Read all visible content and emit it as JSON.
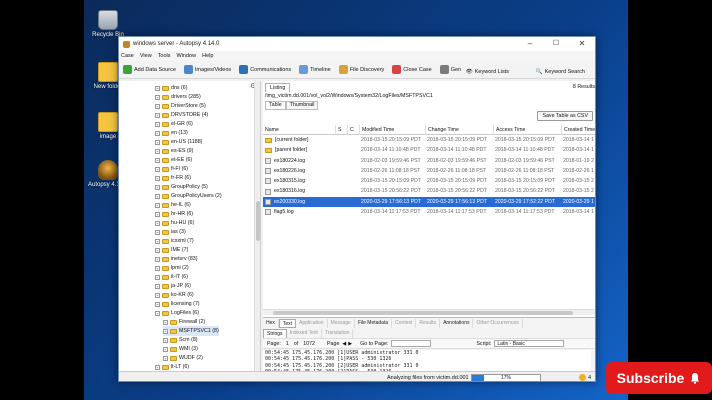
{
  "desktop": {
    "icons": [
      {
        "label": "Recycle Bin",
        "type": "bin"
      },
      {
        "label": "New folder",
        "type": "folder"
      },
      {
        "label": "image",
        "type": "folder"
      },
      {
        "label": "Autopsy 4.14.0",
        "type": "autopsy"
      }
    ]
  },
  "window": {
    "title": "windows server - Autopsy 4.14.0",
    "controls": [
      "–",
      "☐",
      "✕"
    ]
  },
  "menu": [
    "Case",
    "View",
    "Tools",
    "Window",
    "Help"
  ],
  "toolbar": {
    "buttons": [
      {
        "label": "Add Data Source",
        "icon": "plus-icon",
        "color": "#3aa33a"
      },
      {
        "label": "Images/Videos",
        "icon": "image-icon",
        "color": "#4a86c8"
      },
      {
        "label": "Communications",
        "icon": "comm-icon",
        "color": "#2f6fb5"
      },
      {
        "label": "Timeline",
        "icon": "timeline-icon",
        "color": "#6a9bd8"
      },
      {
        "label": "File Discovery",
        "icon": "discovery-icon",
        "color": "#d8a23a"
      },
      {
        "label": "Close Case",
        "icon": "close-case-icon",
        "color": "#d64545"
      },
      {
        "label": "Gen",
        "icon": "report-icon",
        "color": "#7a7a7a"
      }
    ],
    "keyword_lists": "Keyword Lists",
    "keyword_search": "Keyword Search"
  },
  "tree": {
    "items": [
      {
        "label": "dns (6)",
        "indent": 2,
        "plus": true
      },
      {
        "label": "drivers (285)",
        "indent": 2,
        "plus": true
      },
      {
        "label": "DriverStore (5)",
        "indent": 2,
        "plus": true
      },
      {
        "label": "DRVSTORE (4)",
        "indent": 2,
        "plus": true
      },
      {
        "label": "el-GR (6)",
        "indent": 2,
        "plus": true
      },
      {
        "label": "en (13)",
        "indent": 2,
        "plus": true
      },
      {
        "label": "en-US (1188)",
        "indent": 2,
        "plus": true
      },
      {
        "label": "es-ES (9)",
        "indent": 2,
        "plus": true
      },
      {
        "label": "et-EE (6)",
        "indent": 2,
        "plus": true
      },
      {
        "label": "fi-FI (6)",
        "indent": 2,
        "plus": true
      },
      {
        "label": "fr-FR (6)",
        "indent": 2,
        "plus": true
      },
      {
        "label": "GroupPolicy (5)",
        "indent": 2,
        "plus": true
      },
      {
        "label": "GroupPolicyUsers (2)",
        "indent": 2,
        "plus": true
      },
      {
        "label": "he-IL (6)",
        "indent": 2,
        "plus": true
      },
      {
        "label": "hr-HR (6)",
        "indent": 2,
        "plus": true
      },
      {
        "label": "hu-HU (6)",
        "indent": 2,
        "plus": true
      },
      {
        "label": "ias (3)",
        "indent": 2,
        "plus": true
      },
      {
        "label": "icsxml (7)",
        "indent": 2,
        "plus": true
      },
      {
        "label": "IME (7)",
        "indent": 2,
        "plus": true
      },
      {
        "label": "inetsrv (83)",
        "indent": 2,
        "plus": true
      },
      {
        "label": "lpmi (2)",
        "indent": 2,
        "plus": true
      },
      {
        "label": "it-IT (6)",
        "indent": 2,
        "plus": true
      },
      {
        "label": "ja-JP (6)",
        "indent": 2,
        "plus": true
      },
      {
        "label": "ko-KR (6)",
        "indent": 2,
        "plus": true
      },
      {
        "label": "licensing (7)",
        "indent": 2,
        "plus": true
      },
      {
        "label": "LogFiles (6)",
        "indent": 2,
        "plus": true
      },
      {
        "label": "Firewall (2)",
        "indent": 3,
        "plus": true
      },
      {
        "label": "MSFTPSVC1 (8)",
        "indent": 3,
        "plus": true
      },
      {
        "label": "Scm (8)",
        "indent": 3,
        "plus": true
      },
      {
        "label": "WMI (3)",
        "indent": 3,
        "plus": true
      },
      {
        "label": "WUDF (2)",
        "indent": 3,
        "plus": true
      },
      {
        "label": "lt-LT (6)",
        "indent": 2,
        "plus": true
      }
    ]
  },
  "listing": {
    "tab": "Listing",
    "path": "/img_victim.dd.001/vol_vol2/Windows/System32/LogFiles/MSFTPSVC1",
    "results": "8  Results",
    "subtabs": [
      "Table",
      "Thumbnail"
    ],
    "save_button": "Save Table as CSV",
    "columns": [
      "Name",
      "S",
      "C",
      "Modified Time",
      "Change Time",
      "Access Time",
      "Created Time"
    ],
    "rows": [
      {
        "name": "[current folder]",
        "kind": "dir",
        "modified": "2018-03-15 20:15:09 PDT",
        "change": "2018-03-15 20:15:09 PDT",
        "access": "2018-03-15 20:15:09 PDT",
        "created": "2018-03-14 1",
        "selected": false
      },
      {
        "name": "[parent folder]",
        "kind": "dir",
        "modified": "2018-03-14 11:10:48 PDT",
        "change": "2018-03-14 11:10:48 PDT",
        "access": "2018-03-14 11:10:48 PDT",
        "created": "2018-03-14 1",
        "selected": false
      },
      {
        "name": "ex180224.log",
        "kind": "file",
        "modified": "2018-02-03 19:59:46 PST",
        "change": "2018-02-03 19:59:46 PST",
        "access": "2018-02-03 19:59:46 PST",
        "created": "2018-01-19 2",
        "selected": false
      },
      {
        "name": "ex180226.log",
        "kind": "file",
        "modified": "2018-02-26 11:08:18 PST",
        "change": "2018-02-26 11:08:18 PST",
        "access": "2018-02-26 11:08:18 PST",
        "created": "2018-02-26 1",
        "selected": false
      },
      {
        "name": "ex180315.log",
        "kind": "file",
        "modified": "2018-03-15 20:15:09 PDT",
        "change": "2018-03-15 20:15:09 PDT",
        "access": "2018-03-15 20:15:09 PDT",
        "created": "2018-03-15 2",
        "selected": false
      },
      {
        "name": "ex180316.log",
        "kind": "file",
        "modified": "2018-03-15 20:56:22 PDT",
        "change": "2018-03-15 20:56:22 PDT",
        "access": "2018-03-15 20:56:22 PDT",
        "created": "2018-03-15 2",
        "selected": false
      },
      {
        "name": "ex200330.log",
        "kind": "file",
        "modified": "2020-03-29 17:56:13 PDT",
        "change": "2020-03-29 17:56:13 PDT",
        "access": "2020-03-29 17:52:22 PDT",
        "created": "2020-03-29 1",
        "selected": true
      },
      {
        "name": "flag5.log",
        "kind": "file",
        "modified": "2018-03-14 11:17:53 PDT",
        "change": "2018-03-14 11:17:53 PDT",
        "access": "2018-03-14 11:17:53 PDT",
        "created": "2018-03-14 1",
        "selected": false
      }
    ]
  },
  "viewer": {
    "tabs": [
      {
        "label": "Hex",
        "on": false
      },
      {
        "label": "Text",
        "on": true
      },
      {
        "label": "Application",
        "on": false
      },
      {
        "label": "Message",
        "on": false
      },
      {
        "label": "File Metadata",
        "on": false
      },
      {
        "label": "Context",
        "on": false
      },
      {
        "label": "Results",
        "on": false
      },
      {
        "label": "Annotations",
        "on": false
      },
      {
        "label": "Other Occurrences",
        "on": false
      }
    ],
    "subtabs": [
      "Strings",
      "Indexed Text",
      "Translation"
    ],
    "page_label": "Page:",
    "page_current": "1",
    "page_of": "of",
    "page_total": "1072",
    "page_word": "Page",
    "goto_label": "Go to Page:",
    "script_label": "Script:",
    "script_value": "Latin - Basic",
    "lines": [
      "00:54:45 175.45.176.200 [1]USER administrator 331 0",
      "00:54:45 175.45.176.200 [1]PASS - 530 1326",
      "00:54:45 175.45.176.200 [2]USER administrator 331 0",
      "00:54:45 175.45.176.200 [2]PASS - 530 1326",
      "00:54:45 175.45.176.200 [3]USER administrator 331 0",
      "00:54:45 175.45.176.200 [3]PASS - 530 1326",
      "00:54:45 175.45.176.200 [4]USER administrator 331 0",
      "00:54:45 175.45.176.200 [4]PASS - 530 1326"
    ]
  },
  "status": {
    "text": "Analyzing files from victim.dd.001",
    "progress_percent": 17,
    "progress_label": "17%",
    "badge": "4"
  },
  "overlay": {
    "subscribe": "Subscribe"
  }
}
